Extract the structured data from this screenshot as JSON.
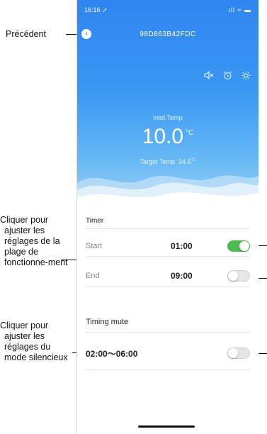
{
  "status_bar": {
    "time": "16:16 ➚",
    "icons": "ıll ≈ ▬"
  },
  "header": {
    "device_id": "98D863B42FDC",
    "icons": [
      "speaker-mute-icon",
      "alarm-clock-icon",
      "sun-icon"
    ],
    "inlet_label": "Inlet Temp",
    "inlet_value": "10.0",
    "inlet_unit": "°C",
    "target_label": "Target Temp",
    "target_value": "34.9",
    "target_unit": "°C"
  },
  "timer": {
    "title": "Timer",
    "start_label": "Start",
    "start_value": "01:00",
    "start_enabled": true,
    "end_label": "End",
    "end_value": "09:00",
    "end_enabled": false
  },
  "timing_mute": {
    "title": "Timing mute",
    "range": "02:00～06:00",
    "enabled": false
  },
  "annotations": {
    "back": "Précédent",
    "timer": "Cliquer pour ajuster les réglages de la plage de fonctionne-ment",
    "mute": "Cliquer pour ajuster les réglages du mode silencieux"
  },
  "colors": {
    "accent": "#2f86f0",
    "toggle_on": "#4cbe4f"
  }
}
